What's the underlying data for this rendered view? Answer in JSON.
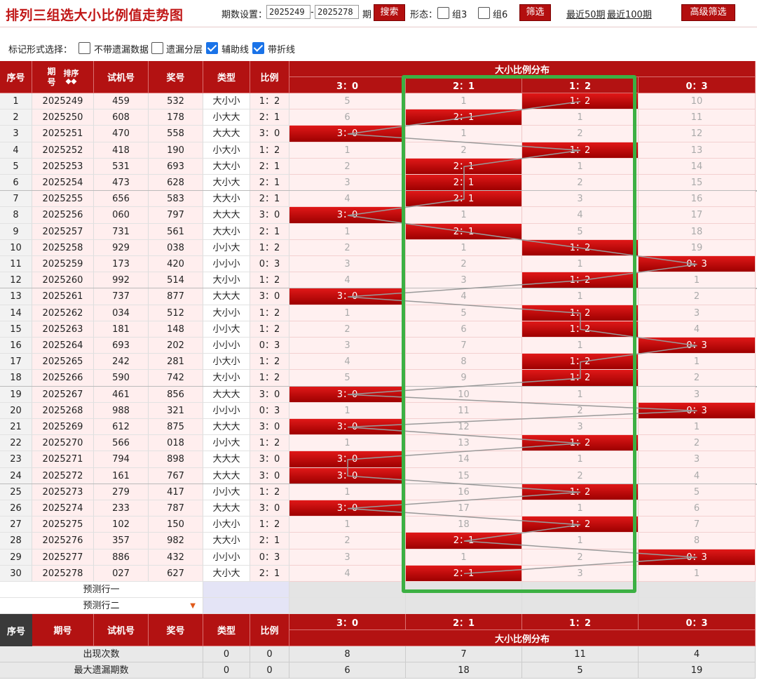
{
  "title": "排列三组选大小比例值走势图",
  "toolbar": {
    "period_label": "期数设置：",
    "start_period": "2025249",
    "dash": "-",
    "end_period": "2025278",
    "period_suffix": "期",
    "search_label": "搜索",
    "form_label": "形态：",
    "group3_label": "组3",
    "group6_label": "组6",
    "filter_label": "筛选",
    "recent50_label": "最近50期",
    "recent100_label": "最近100期",
    "advanced_label": "高级筛选"
  },
  "marks": {
    "label": "标记形式选择：",
    "options": [
      {
        "label": "不带遗漏数据",
        "checked": false
      },
      {
        "label": "遗漏分层",
        "checked": false
      },
      {
        "label": "辅助线",
        "checked": true
      },
      {
        "label": "带折线",
        "checked": true
      }
    ]
  },
  "headers": {
    "index": "序号",
    "period": "期号",
    "sort": "排序",
    "trial": "试机号",
    "prize": "奖号",
    "type": "类型",
    "ratio": "比例",
    "dist": "大小比例分布",
    "ratios": [
      "3：0",
      "2：1",
      "1：2",
      "0：3"
    ]
  },
  "rows": [
    {
      "idx": "1",
      "period": "2025249",
      "trial": "459",
      "prize": "532",
      "type": "大小小",
      "ratio": "1：2",
      "miss": [
        "5",
        "1",
        "1：2",
        "10"
      ]
    },
    {
      "idx": "2",
      "period": "2025250",
      "trial": "608",
      "prize": "178",
      "type": "小大大",
      "ratio": "2：1",
      "miss": [
        "6",
        "2：1",
        "1",
        "11"
      ]
    },
    {
      "idx": "3",
      "period": "2025251",
      "trial": "470",
      "prize": "558",
      "type": "大大大",
      "ratio": "3：0",
      "miss": [
        "3：0",
        "1",
        "2",
        "12"
      ]
    },
    {
      "idx": "4",
      "period": "2025252",
      "trial": "418",
      "prize": "190",
      "type": "小大小",
      "ratio": "1：2",
      "miss": [
        "1",
        "2",
        "1：2",
        "13"
      ]
    },
    {
      "idx": "5",
      "period": "2025253",
      "trial": "531",
      "prize": "693",
      "type": "大大小",
      "ratio": "2：1",
      "miss": [
        "2",
        "2：1",
        "1",
        "14"
      ]
    },
    {
      "idx": "6",
      "period": "2025254",
      "trial": "473",
      "prize": "628",
      "type": "大小大",
      "ratio": "2：1",
      "miss": [
        "3",
        "2：1",
        "2",
        "15"
      ]
    },
    {
      "idx": "7",
      "period": "2025255",
      "trial": "656",
      "prize": "583",
      "type": "大大小",
      "ratio": "2：1",
      "miss": [
        "4",
        "2：1",
        "3",
        "16"
      ]
    },
    {
      "idx": "8",
      "period": "2025256",
      "trial": "060",
      "prize": "797",
      "type": "大大大",
      "ratio": "3：0",
      "miss": [
        "3：0",
        "1",
        "4",
        "17"
      ]
    },
    {
      "idx": "9",
      "period": "2025257",
      "trial": "731",
      "prize": "561",
      "type": "大大小",
      "ratio": "2：1",
      "miss": [
        "1",
        "2：1",
        "5",
        "18"
      ]
    },
    {
      "idx": "10",
      "period": "2025258",
      "trial": "929",
      "prize": "038",
      "type": "小小大",
      "ratio": "1：2",
      "miss": [
        "2",
        "1",
        "1：2",
        "19"
      ]
    },
    {
      "idx": "11",
      "period": "2025259",
      "trial": "173",
      "prize": "420",
      "type": "小小小",
      "ratio": "0：3",
      "miss": [
        "3",
        "2",
        "1",
        "0：3"
      ]
    },
    {
      "idx": "12",
      "period": "2025260",
      "trial": "992",
      "prize": "514",
      "type": "大小小",
      "ratio": "1：2",
      "miss": [
        "4",
        "3",
        "1：2",
        "1"
      ]
    },
    {
      "idx": "13",
      "period": "2025261",
      "trial": "737",
      "prize": "877",
      "type": "大大大",
      "ratio": "3：0",
      "miss": [
        "3：0",
        "4",
        "1",
        "2"
      ]
    },
    {
      "idx": "14",
      "period": "2025262",
      "trial": "034",
      "prize": "512",
      "type": "大小小",
      "ratio": "1：2",
      "miss": [
        "1",
        "5",
        "1：2",
        "3"
      ]
    },
    {
      "idx": "15",
      "period": "2025263",
      "trial": "181",
      "prize": "148",
      "type": "小小大",
      "ratio": "1：2",
      "miss": [
        "2",
        "6",
        "1：2",
        "4"
      ]
    },
    {
      "idx": "16",
      "period": "2025264",
      "trial": "693",
      "prize": "202",
      "type": "小小小",
      "ratio": "0：3",
      "miss": [
        "3",
        "7",
        "1",
        "0：3"
      ]
    },
    {
      "idx": "17",
      "period": "2025265",
      "trial": "242",
      "prize": "281",
      "type": "小大小",
      "ratio": "1：2",
      "miss": [
        "4",
        "8",
        "1：2",
        "1"
      ]
    },
    {
      "idx": "18",
      "period": "2025266",
      "trial": "590",
      "prize": "742",
      "type": "大小小",
      "ratio": "1：2",
      "miss": [
        "5",
        "9",
        "1：2",
        "2"
      ]
    },
    {
      "idx": "19",
      "period": "2025267",
      "trial": "461",
      "prize": "856",
      "type": "大大大",
      "ratio": "3：0",
      "miss": [
        "3：0",
        "10",
        "1",
        "3"
      ]
    },
    {
      "idx": "20",
      "period": "2025268",
      "trial": "988",
      "prize": "321",
      "type": "小小小",
      "ratio": "0：3",
      "miss": [
        "1",
        "11",
        "2",
        "0：3"
      ]
    },
    {
      "idx": "21",
      "period": "2025269",
      "trial": "612",
      "prize": "875",
      "type": "大大大",
      "ratio": "3：0",
      "miss": [
        "3：0",
        "12",
        "3",
        "1"
      ]
    },
    {
      "idx": "22",
      "period": "2025270",
      "trial": "566",
      "prize": "018",
      "type": "小小大",
      "ratio": "1：2",
      "miss": [
        "1",
        "13",
        "1：2",
        "2"
      ]
    },
    {
      "idx": "23",
      "period": "2025271",
      "trial": "794",
      "prize": "898",
      "type": "大大大",
      "ratio": "3：0",
      "miss": [
        "3：0",
        "14",
        "1",
        "3"
      ]
    },
    {
      "idx": "24",
      "period": "2025272",
      "trial": "161",
      "prize": "767",
      "type": "大大大",
      "ratio": "3：0",
      "miss": [
        "3：0",
        "15",
        "2",
        "4"
      ]
    },
    {
      "idx": "25",
      "period": "2025273",
      "trial": "279",
      "prize": "417",
      "type": "小小大",
      "ratio": "1：2",
      "miss": [
        "1",
        "16",
        "1：2",
        "5"
      ]
    },
    {
      "idx": "26",
      "period": "2025274",
      "trial": "233",
      "prize": "787",
      "type": "大大大",
      "ratio": "3：0",
      "miss": [
        "3：0",
        "17",
        "1",
        "6"
      ]
    },
    {
      "idx": "27",
      "period": "2025275",
      "trial": "102",
      "prize": "150",
      "type": "小大小",
      "ratio": "1：2",
      "miss": [
        "1",
        "18",
        "1：2",
        "7"
      ]
    },
    {
      "idx": "28",
      "period": "2025276",
      "trial": "357",
      "prize": "982",
      "type": "大大小",
      "ratio": "2：1",
      "miss": [
        "2",
        "2：1",
        "1",
        "8"
      ]
    },
    {
      "idx": "29",
      "period": "2025277",
      "trial": "886",
      "prize": "432",
      "type": "小小小",
      "ratio": "0：3",
      "miss": [
        "3",
        "1",
        "2",
        "0：3"
      ]
    },
    {
      "idx": "30",
      "period": "2025278",
      "trial": "027",
      "prize": "627",
      "type": "大小大",
      "ratio": "2：1",
      "miss": [
        "4",
        "2：1",
        "3",
        "1"
      ]
    }
  ],
  "predict": [
    "预测行一",
    "预测行二"
  ],
  "summary": [
    {
      "label": "出现次数",
      "type": "0",
      "ratio": "0",
      "vals": [
        "8",
        "7",
        "11",
        "4"
      ]
    },
    {
      "label": "最大遗漏期数",
      "type": "0",
      "ratio": "0",
      "vals": [
        "6",
        "18",
        "5",
        "19"
      ]
    }
  ],
  "colors": {
    "accent": "#b31212",
    "highlight_box": "#3cb043",
    "line": "#9a9a9a"
  }
}
